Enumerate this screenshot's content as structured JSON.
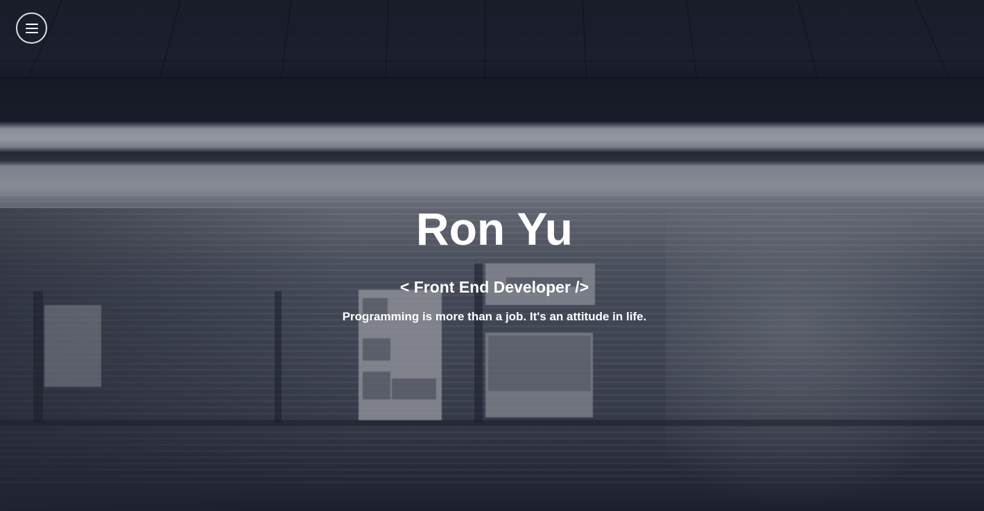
{
  "hero": {
    "name": "Ron Yu",
    "subtitle": "< Front End Developer />",
    "tagline": "Programming is more than a job. It's an attitude in life."
  },
  "menu": {
    "icon": "hamburger-icon"
  },
  "colors": {
    "text": "#ffffff",
    "overlay": "#161a28"
  }
}
